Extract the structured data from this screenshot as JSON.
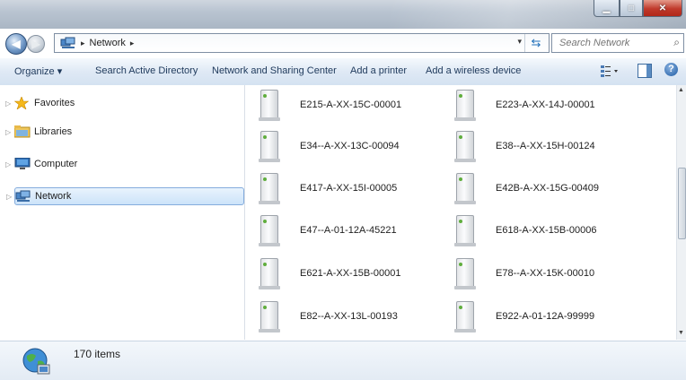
{
  "window": {
    "colors": {
      "titlebar": "#b9c4d1",
      "close": "#c0392b",
      "toolbar": "#dfe9f5",
      "selection": "#cce3f9"
    },
    "buttons": {
      "minimize": "minimize-icon",
      "maximize": "maximize-icon",
      "close": "close-icon"
    }
  },
  "address": {
    "crumbs": [
      "Network"
    ],
    "search_placeholder": "Search Network"
  },
  "toolbar": {
    "organize": "Organize ▾",
    "search_ad": "Search Active Directory",
    "network_sharing": "Network and Sharing Center",
    "add_printer": "Add a printer",
    "add_wireless": "Add a wireless device",
    "help": "?"
  },
  "nav": {
    "items": [
      {
        "label": "Favorites",
        "icon": "star-icon"
      },
      {
        "label": "Libraries",
        "icon": "library-folder-icon"
      },
      {
        "label": "Computer",
        "icon": "computer-icon"
      },
      {
        "label": "Network",
        "icon": "network-icon",
        "selected": true
      }
    ]
  },
  "content": {
    "computers": [
      "E215-A-XX-15C-00001",
      "E223-A-XX-14J-00001",
      "E34--A-XX-13C-00094",
      "E38--A-XX-15H-00124",
      "E417-A-XX-15I-00005",
      "E42B-A-XX-15G-00409",
      "E47--A-01-12A-45221",
      "E618-A-XX-15B-00006",
      "E621-A-XX-15B-00001",
      "E78--A-XX-15K-00010",
      "E82--A-XX-13L-00193",
      "E922-A-01-12A-99999"
    ]
  },
  "details": {
    "count": "170 items"
  }
}
